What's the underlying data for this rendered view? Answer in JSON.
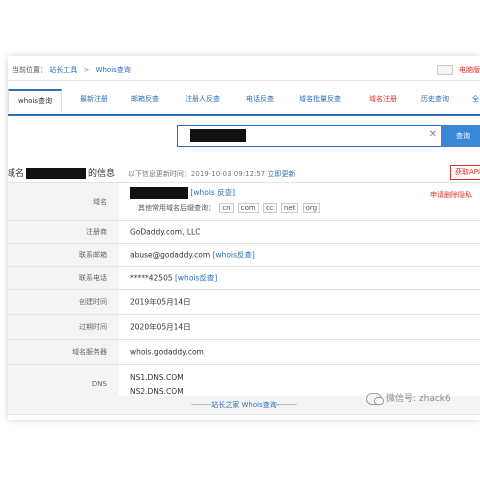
{
  "breadcrumb": {
    "prefix": "当前位置：",
    "home": "站长工具",
    "separator": ">",
    "current": "Whois查询"
  },
  "top_right": {
    "text": "电脑版"
  },
  "tabs": [
    {
      "label": "whois查询",
      "active": true
    },
    {
      "label": "最新注册"
    },
    {
      "label": "邮箱反查"
    },
    {
      "label": "注册人反查"
    },
    {
      "label": "电话反查"
    },
    {
      "label": "域名批量反查"
    },
    {
      "label": "域名注册",
      "color": "#e0302c"
    },
    {
      "label": "历史查询"
    },
    {
      "label": "全"
    }
  ],
  "search": {
    "clear_glyph": "✕",
    "button_label": "查询"
  },
  "info_header": {
    "title_prefix": "域名",
    "title_suffix": "的信息",
    "update_text": "以下信息更新时间：2019-10-03 09:12:57",
    "update_link": "立即更新"
  },
  "api_button": "获取API",
  "rows": {
    "domain": {
      "label": "域名",
      "whois_link": "[whois 反查]",
      "suffix_text": "其他常用域名后缀查询：",
      "suffixes": [
        "cn",
        "com",
        "cc",
        "net",
        "org"
      ],
      "privacy": "申请删除隐私"
    },
    "registrar": {
      "label": "注册商",
      "value": "GoDaddy.com, LLC"
    },
    "email": {
      "label": "联系邮箱",
      "value": "abuse@godaddy.com",
      "link": "[whois反查]"
    },
    "phone": {
      "label": "联系电话",
      "value": "*****42505",
      "link": "[whois反查]"
    },
    "created": {
      "label": "创建时间",
      "value": "2019年05月14日"
    },
    "expires": {
      "label": "过期时间",
      "value": "2020年05月14日"
    },
    "server": {
      "label": "域名服务器",
      "value": "whois.godaddy.com"
    },
    "dns": {
      "label": "DNS",
      "values": [
        "NS1.DNS.COM",
        "NS2.DNS.COM"
      ]
    }
  },
  "footer": "--------站长之家 Whois查询--------",
  "watermark": "微信号: zhack6"
}
